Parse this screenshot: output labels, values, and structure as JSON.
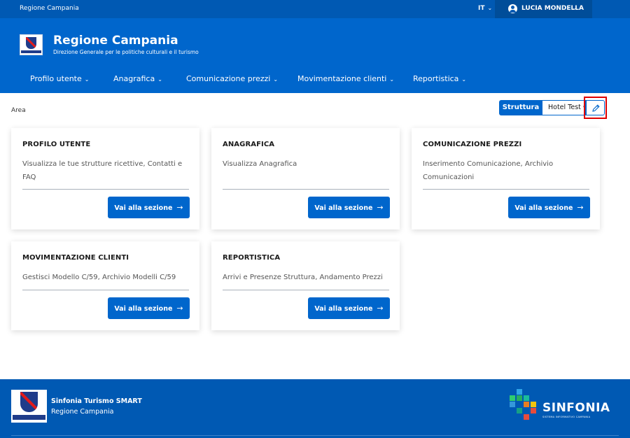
{
  "topbar": {
    "brand": "Regione Campania",
    "language": "IT",
    "user_name": "LUCIA MONDELLA",
    "chevron_icon": "chevron-down-icon",
    "avatar_icon": "user-avatar-icon"
  },
  "header": {
    "title": "Regione Campania",
    "subtitle": "Direzione Generale per le politiche culturali e il turismo",
    "logo_icon": "region-crest-icon"
  },
  "nav": {
    "items": [
      {
        "label": "Profilo utente"
      },
      {
        "label": "Anagrafica"
      },
      {
        "label": "Comunicazione prezzi"
      },
      {
        "label": "Movimentazione clienti"
      },
      {
        "label": "Reportistica"
      }
    ]
  },
  "area": {
    "label": "Area",
    "struttura_label": "Struttura",
    "selected_structure": "Hotel Test",
    "edit_icon": "pencil-icon"
  },
  "cards": [
    {
      "title": "PROFILO UTENTE",
      "description": "Visualizza le tue strutture ricettive, Contatti e FAQ",
      "button": "Vai alla sezione"
    },
    {
      "title": "ANAGRAFICA",
      "description": "Visualizza Anagrafica",
      "button": "Vai alla sezione"
    },
    {
      "title": "COMUNICAZIONE PREZZI",
      "description": "Inserimento Comunicazione, Archivio Comunicazioni",
      "button": "Vai alla sezione"
    },
    {
      "title": "MOVIMENTAZIONE CLIENTI",
      "description": "Gestisci Modello C/59, Archivio Modelli C/59",
      "button": "Vai alla sezione"
    },
    {
      "title": "REPORTISTICA",
      "description": "Arrivi e Presenze Struttura, Andamento Prezzi",
      "button": "Vai alla sezione"
    }
  ],
  "footer": {
    "title": "Sinfonia Turismo SMART",
    "subtitle": "Regione Campania",
    "sinfonia_name": "SINFONIA",
    "sinfonia_tagline": "SISTEMA INFORMATIVO CAMPANIA",
    "colors": {
      "accent": "#0066cc",
      "dark": "#0059b3",
      "highlight": "#e00000"
    }
  }
}
